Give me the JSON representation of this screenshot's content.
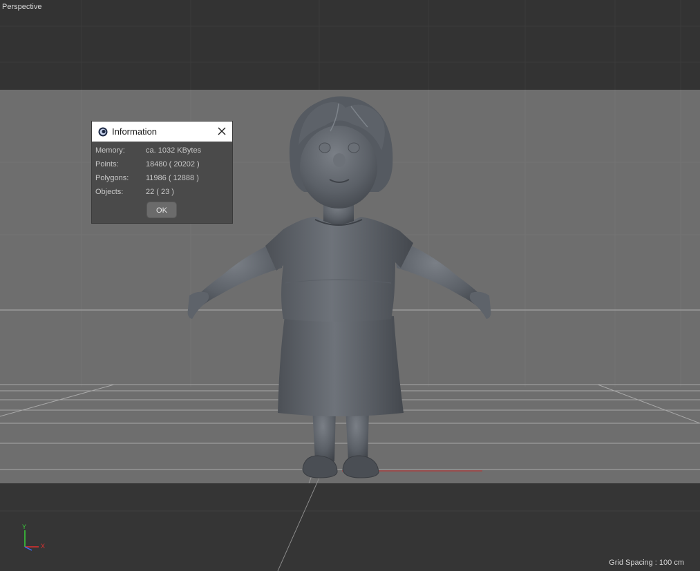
{
  "viewport": {
    "view_name": "Perspective",
    "grid_spacing": "Grid Spacing : 100 cm",
    "axis_labels": {
      "y": "Y",
      "x": "X"
    },
    "colors": {
      "background_top": "#333333",
      "backdrop": "#6e6e6e",
      "floor": "#6a6a6a",
      "axis_x": "#e03030",
      "axis_y": "#3ad13a",
      "axis_z": "#3a6cff"
    }
  },
  "dialog": {
    "title": "Information",
    "icon": "cinema4d-app-icon",
    "close_icon": "close-icon",
    "rows": [
      {
        "label": "Memory:",
        "value": "ca. 1032 KBytes"
      },
      {
        "label": "Points:",
        "value": "18480 ( 20202 )"
      },
      {
        "label": "Polygons:",
        "value": "11986 ( 12888 )"
      },
      {
        "label": "Objects:",
        "value": "22 ( 23 )"
      }
    ],
    "ok_label": "OK"
  }
}
